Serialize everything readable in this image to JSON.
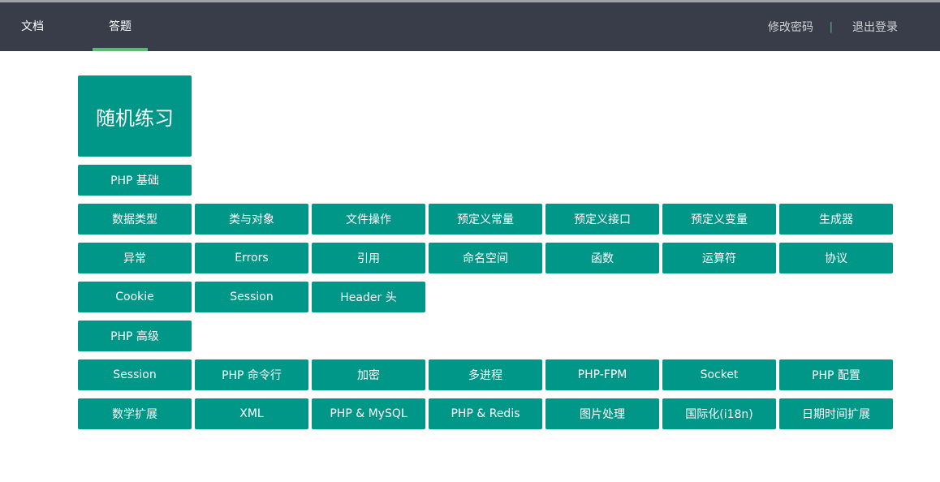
{
  "nav": {
    "left": [
      {
        "label": "文档",
        "active": false
      },
      {
        "label": "答题",
        "active": true
      }
    ],
    "right": {
      "change_password": "修改密码",
      "separator": "|",
      "logout": "退出登录"
    }
  },
  "practice": {
    "random_label": "随机练习"
  },
  "sections": [
    {
      "title": "PHP 基础",
      "items": [
        "数据类型",
        "类与对象",
        "文件操作",
        "预定义常量",
        "预定义接口",
        "预定义变量",
        "生成器",
        "异常",
        "Errors",
        "引用",
        "命名空间",
        "函数",
        "运算符",
        "协议",
        "Cookie",
        "Session",
        "Header 头"
      ]
    },
    {
      "title": "PHP 高级",
      "items": [
        "Session",
        "PHP 命令行",
        "加密",
        "多进程",
        "PHP-FPM",
        "Socket",
        "PHP 配置",
        "数学扩展",
        "XML",
        "PHP & MySQL",
        "PHP & Redis",
        "图片处理",
        "国际化(i18n)",
        "日期时间扩展"
      ]
    }
  ],
  "colors": {
    "topbar": "#393d49",
    "accent": "#009688",
    "nav_active_underline": "#5fb878"
  }
}
